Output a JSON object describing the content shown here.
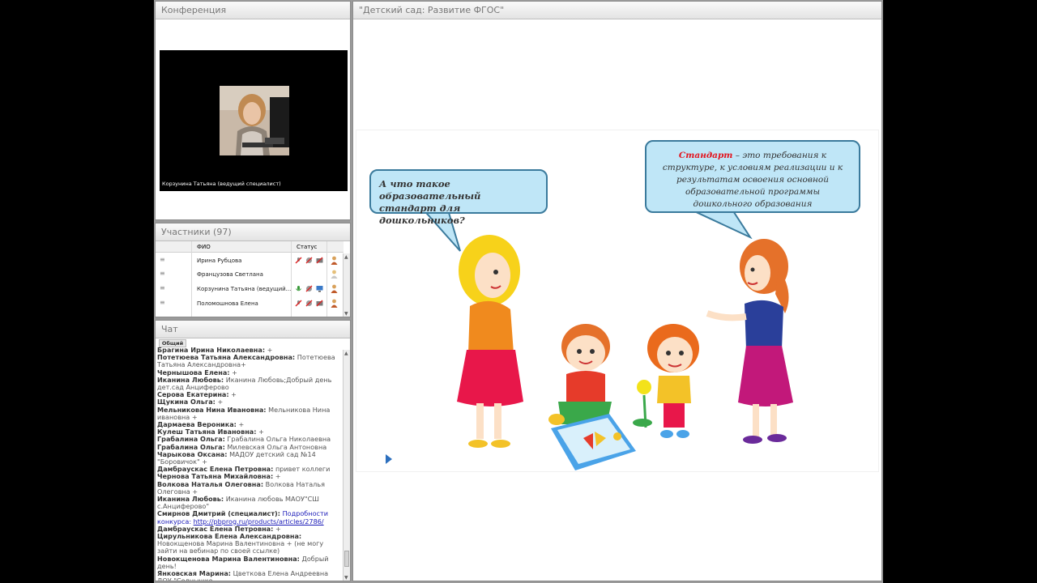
{
  "conference": {
    "title": "Конференция",
    "video_caption": "Корзунина Татьяна (ведущий специалист)"
  },
  "participants": {
    "title": "Участники (97)",
    "col_name": "ФИО",
    "col_status": "Статус",
    "rows": [
      {
        "name": "Ирина Рубцова"
      },
      {
        "name": "Французова Светлана"
      },
      {
        "name": "Корзунина Татьяна (ведущий..."
      },
      {
        "name": "Поломошнова Елена"
      }
    ]
  },
  "chat": {
    "title": "Чат",
    "tab": "Общий",
    "messages": [
      {
        "author": "Брагина Ирина  Николаевна:",
        "text": " +"
      },
      {
        "author": "Потетюева Татьяна  Александровна:",
        "text": " Потетюева Татьяна Александровна+"
      },
      {
        "author": "Чернышова  Елена:",
        "text": " +"
      },
      {
        "author": "Иканина Любовь:",
        "text": " Иканина Любовь;Добрый день дет.сад Анциферово"
      },
      {
        "author": "Серова Екатерина:",
        "text": " +"
      },
      {
        "author": "Щукина Ольга:",
        "text": " +"
      },
      {
        "author": "Мельникова Нина  Ивановна:",
        "text": " Мельникова Нина ивановна +"
      },
      {
        "author": "Дармаева Вероника:",
        "text": " +"
      },
      {
        "author": "Кулеш Татьяна  Ивановна:",
        "text": " +"
      },
      {
        "author": "Грабалина Ольга:",
        "text": " Грабалина Ольга Николаевна"
      },
      {
        "author": "Грабалина Ольга:",
        "text": " Милевская Ольга Антоновна"
      },
      {
        "author": "Чарыкова Оксана:",
        "text": " МАДОУ детский сад №14 \"Боровичок\" +"
      },
      {
        "author": "Дамбраускас Елена Петровна:",
        "text": " привет коллеги"
      },
      {
        "author": "Чернова Татьяна Михайловна:",
        "text": " +"
      },
      {
        "author": "Волкова Наталья  Олеговна:",
        "text": " Волкова Наталья Олеговна +"
      },
      {
        "author": "Иканина Любовь:",
        "text": " Иканина любовь МАОУ\"СШ с.Анциферово\""
      },
      {
        "author": "Смирнов Дмитрий  (специалист):",
        "text": " Подробности конкурса: ",
        "link": "http://pbprog.ru/products/articles/2786/"
      },
      {
        "author": "Дамбраускас Елена Петровна:",
        "text": " +"
      },
      {
        "author": "Цирульникова Елена  Александровна:",
        "text": " Новокщенова Марина Валентиновна + (не могу зайти на вебинар по своей ссылке)"
      },
      {
        "author": "Новокщенова Марина Валентиновна:",
        "text": " Добрый день!"
      },
      {
        "author": "Янковская  Марина:",
        "text": " Цветкова Елена Андреевна ДОУ \"Солнышко"
      }
    ]
  },
  "presentation": {
    "title": "\"Детский сад: Развитие ФГОС\"",
    "question": "А что такое образовательный стандарт для дошкольников?",
    "definition_term": "Стандарт",
    "definition_text": " – это требования к структуре, к условиям реализации и к результатам освоения основной образовательной программы дошкольного образования"
  },
  "colors": {
    "bubble_fill": "#bfe6f7",
    "bubble_border": "#3a7a9c",
    "accent_red": "#e3141e",
    "play_blue": "#2c6fbe"
  }
}
